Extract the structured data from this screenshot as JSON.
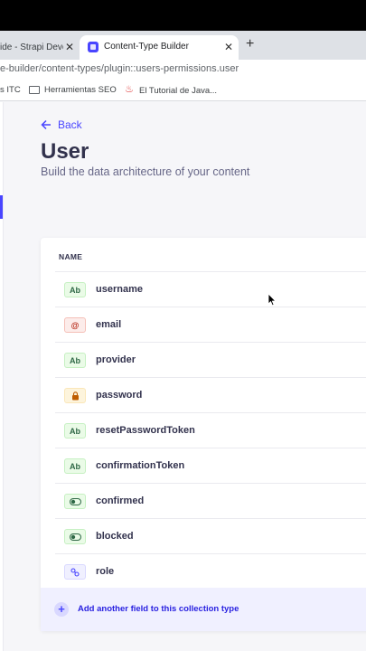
{
  "browser": {
    "inactive_tab": "ide - Strapi Deve",
    "active_tab": "Content-Type Builder",
    "close_symbol": "✕",
    "new_tab_symbol": "+",
    "url": "e-builder/content-types/plugin::users-permissions.user",
    "bookmarks": [
      "s ITC",
      "Herramientas SEO",
      "El Tutorial de Java..."
    ]
  },
  "header": {
    "back_label": "Back",
    "title": "User",
    "subtitle": "Build the data architecture of your content"
  },
  "table": {
    "column_name": "NAME",
    "rows": [
      {
        "icon": "text-icon",
        "badge": "Ab",
        "name": "username"
      },
      {
        "icon": "email-icon",
        "badge": "@",
        "name": "email"
      },
      {
        "icon": "text-icon",
        "badge": "Ab",
        "name": "provider"
      },
      {
        "icon": "password-icon",
        "badge": "",
        "name": "password"
      },
      {
        "icon": "text-icon",
        "badge": "Ab",
        "name": "resetPasswordToken"
      },
      {
        "icon": "text-icon",
        "badge": "Ab",
        "name": "confirmationToken"
      },
      {
        "icon": "boolean-icon",
        "badge": "",
        "name": "confirmed"
      },
      {
        "icon": "boolean-icon",
        "badge": "",
        "name": "blocked"
      },
      {
        "icon": "relation-icon",
        "badge": "",
        "name": "role"
      }
    ],
    "add_label": "Add another field to this collection type"
  },
  "colors": {
    "accent": "#4945ff",
    "text_badge_bg": "#eafbe7",
    "email_badge_bg": "#fcecea",
    "password_badge_bg": "#fdf4dc"
  }
}
